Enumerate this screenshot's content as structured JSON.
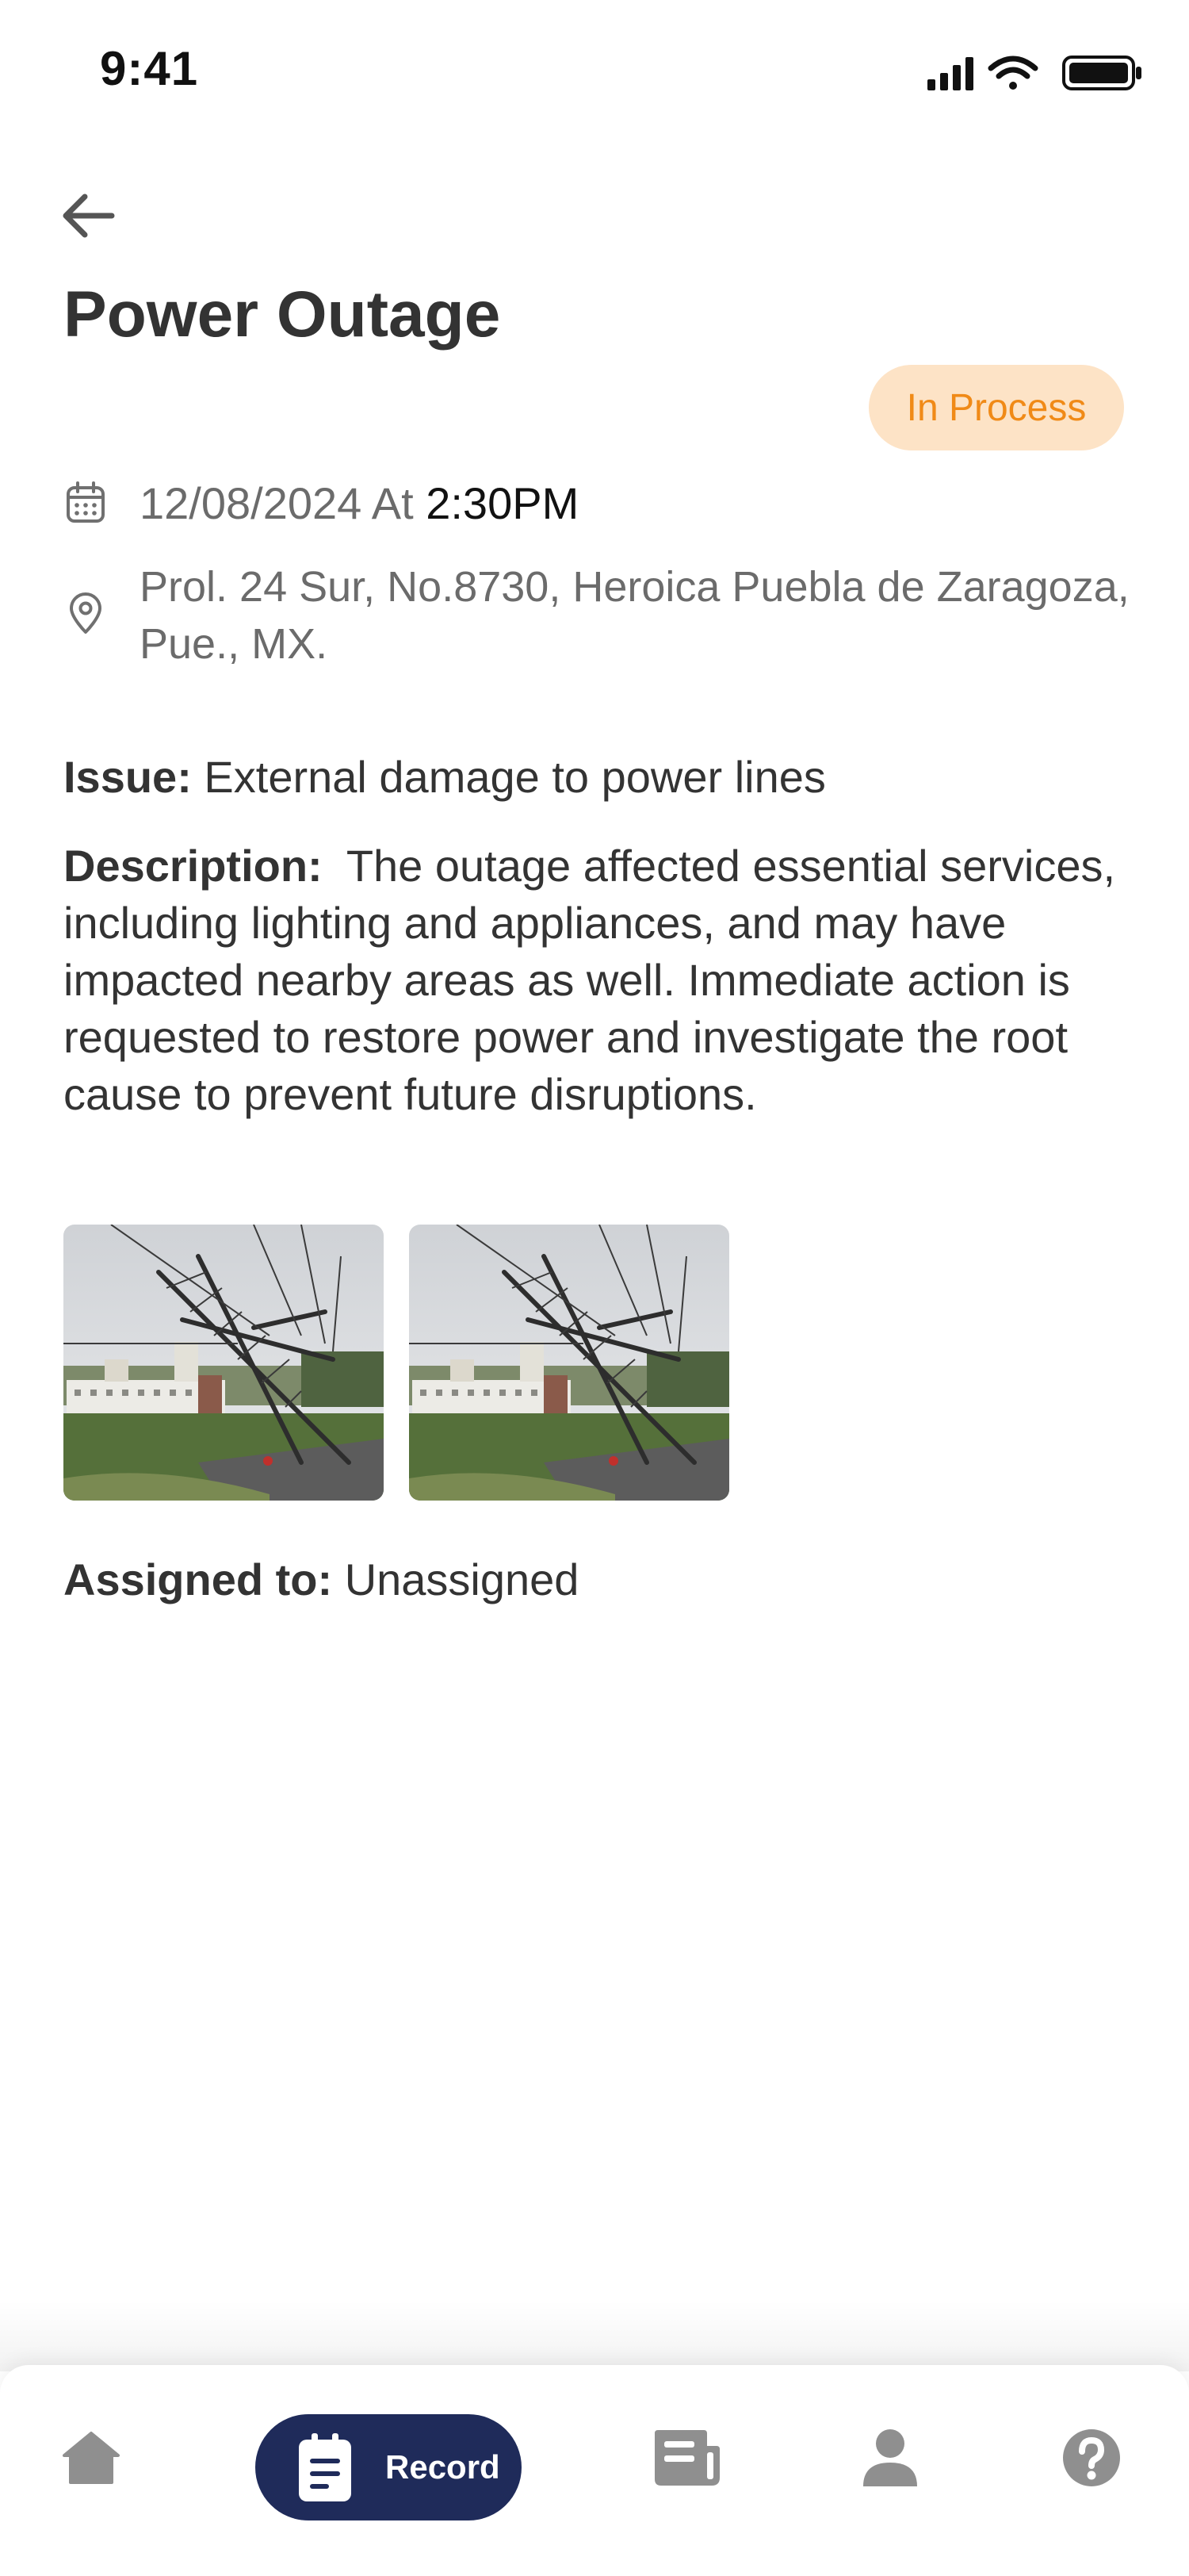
{
  "status_bar": {
    "time": "9:41"
  },
  "header": {
    "title": "Power Outage",
    "status": "In Process"
  },
  "report": {
    "date": "12/08/2024 At",
    "time": "2:30PM",
    "address": "Prol. 24 Sur, No.8730, Heroica Puebla de Zaragoza, Pue., MX.",
    "issue_label": "Issue:",
    "issue_value": "External damage to power lines",
    "description_label": "Description:",
    "description_value": "The outage affected essential services, including lighting and appliances, and may have impacted nearby areas as well. Immediate action is requested to restore power and investigate the root cause to prevent future disruptions.",
    "assigned_label": "Assigned to:",
    "assigned_value": "Unassigned"
  },
  "bottom_nav": {
    "items": [
      {
        "icon": "home-icon"
      },
      {
        "icon": "record-icon",
        "label": "Record"
      },
      {
        "icon": "news-icon"
      },
      {
        "icon": "profile-icon"
      },
      {
        "icon": "help-icon"
      }
    ]
  },
  "colors": {
    "accent": "#f08a17",
    "badge_bg": "#fde3c6",
    "nav_active": "#1f2b5a",
    "nav_inactive": "#8f8f8f"
  }
}
